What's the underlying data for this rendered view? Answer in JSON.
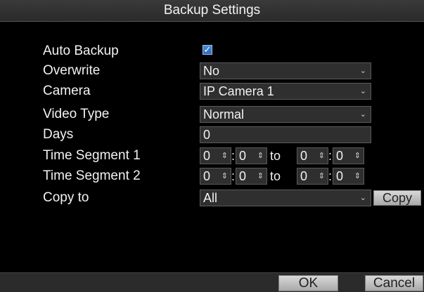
{
  "window": {
    "title": "Backup Settings"
  },
  "form": {
    "auto_backup": {
      "label": "Auto Backup",
      "checked": true
    },
    "overwrite": {
      "label": "Overwrite",
      "value": "No"
    },
    "camera": {
      "label": "Camera",
      "value": "IP Camera 1"
    },
    "video_type": {
      "label": "Video Type",
      "value": "Normal"
    },
    "days": {
      "label": "Days",
      "value": "0"
    },
    "time_segment_1": {
      "label": "Time Segment 1",
      "start_h": "0",
      "start_m": "0",
      "to": "to",
      "end_h": "0",
      "end_m": "0"
    },
    "time_segment_2": {
      "label": "Time Segment 2",
      "start_h": "0",
      "start_m": "0",
      "to": "to",
      "end_h": "0",
      "end_m": "0"
    },
    "copy_to": {
      "label": "Copy to",
      "value": "All"
    }
  },
  "buttons": {
    "copy": "Copy",
    "ok": "OK",
    "cancel": "Cancel"
  },
  "icons": {
    "checkbox": "check-icon",
    "dropdown": "chevron-down-icon",
    "spinner": "spinner-updown-icon"
  },
  "colors": {
    "background": "#000000",
    "field": "#2f2f2f",
    "check_accent": "#2f6bbb"
  }
}
